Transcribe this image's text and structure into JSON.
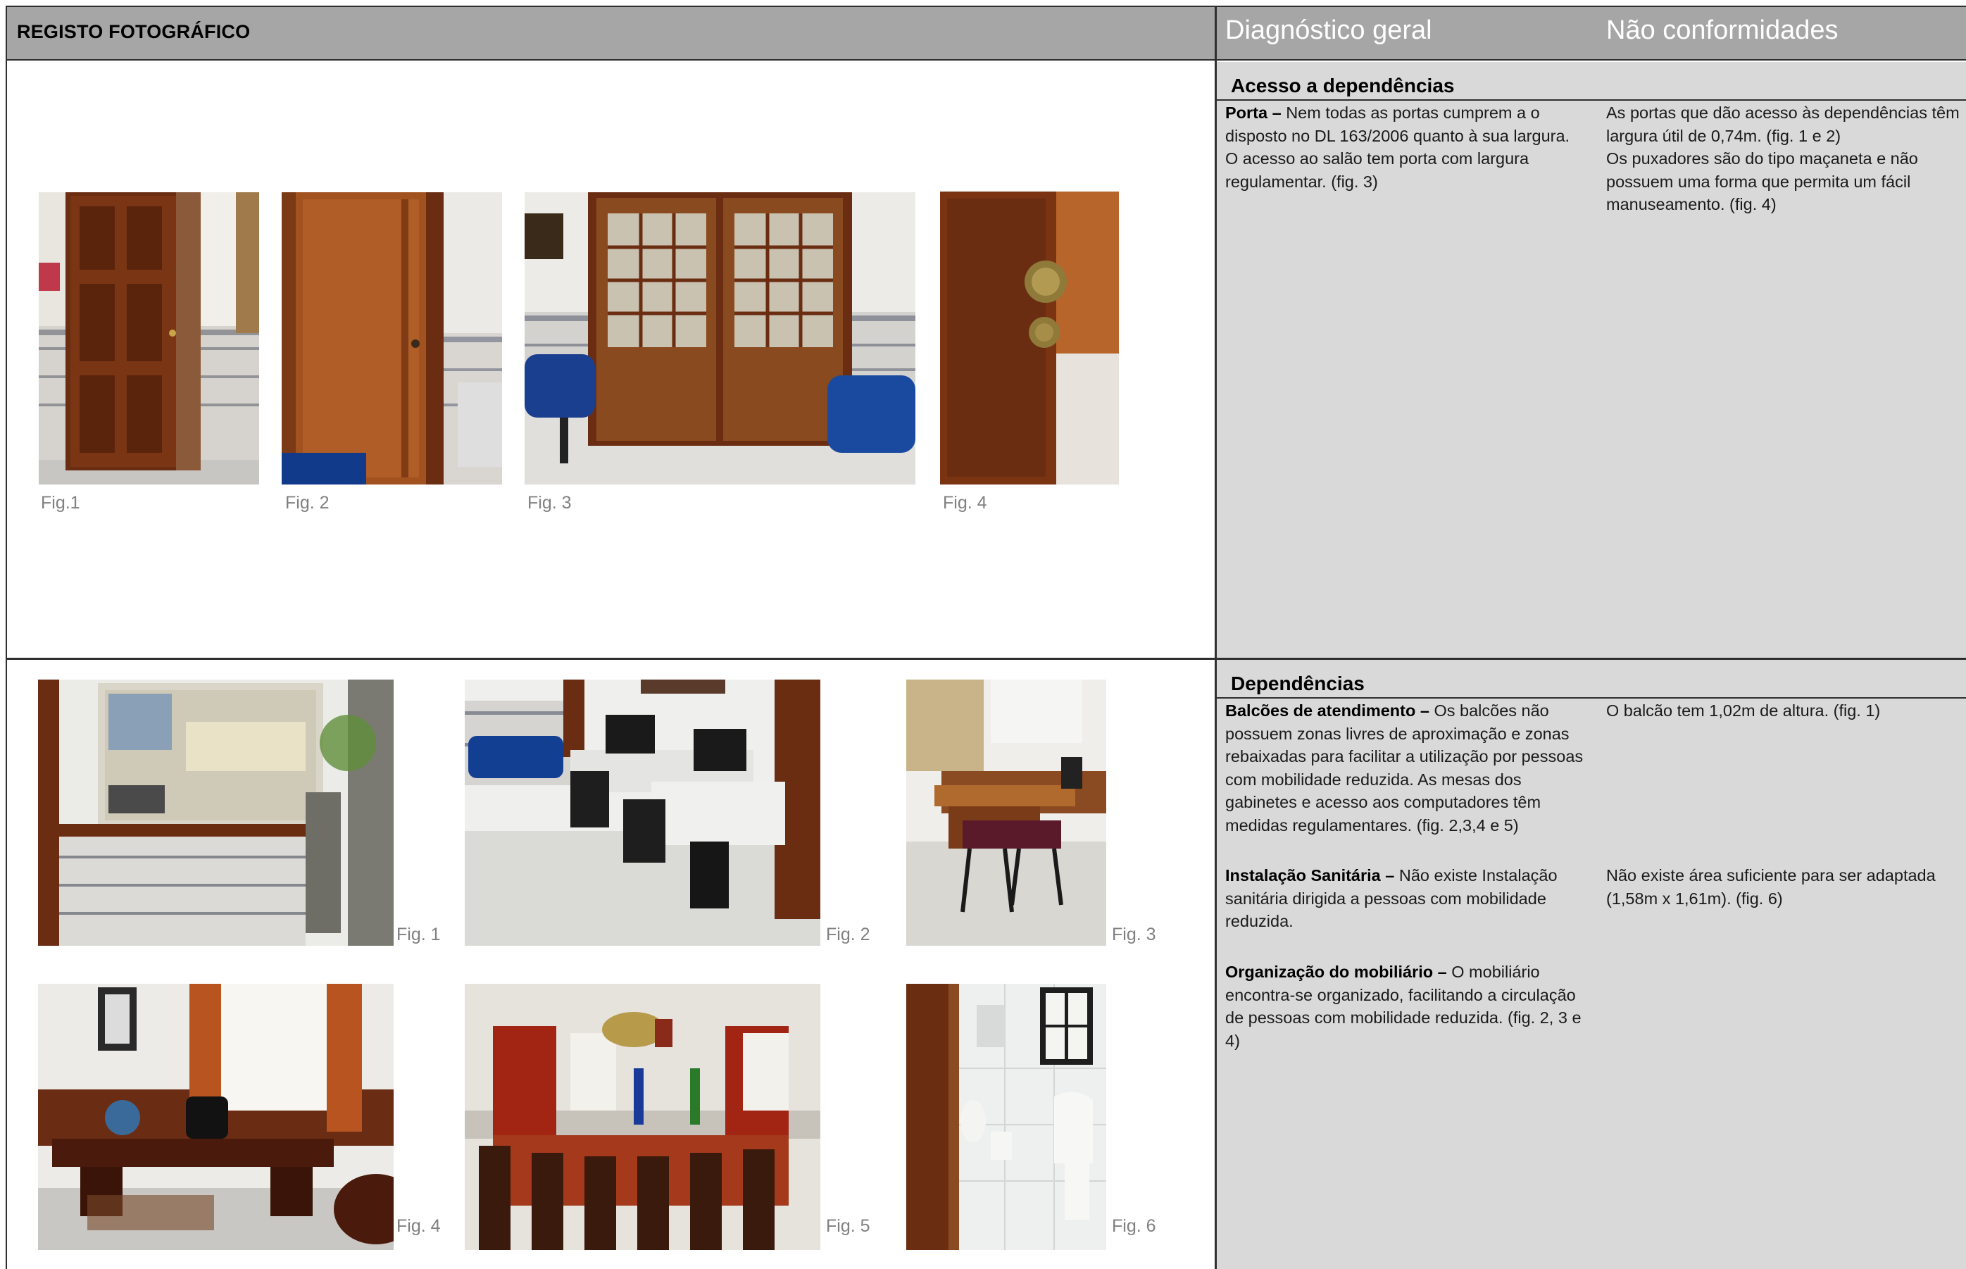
{
  "header": {
    "title": "REGISTO FOTOGRÁFICO",
    "col_diagnostico": "Diagnóstico geral",
    "col_nao_conformidades": "Não conformidades"
  },
  "section1": {
    "heading": "Acesso a dependências",
    "diagnostico": {
      "lead": "Porta – ",
      "text": "Nem todas as portas cumprem a o disposto no DL 163/2006 quanto à sua largura. O acesso ao salão tem porta com largura regulamentar. (fig. 3)"
    },
    "nao_conformidades": {
      "line1": "As portas que dão acesso às dependências têm largura útil de 0,74m. (fig. 1 e 2)",
      "line2": "Os puxadores são do tipo maçaneta e não possuem uma forma que permita um fácil manuseamento. (fig. 4)"
    },
    "captions": [
      "Fig.1",
      "Fig. 2",
      "Fig. 3",
      "Fig. 4"
    ]
  },
  "section2": {
    "heading": "Dependências",
    "diagnostico": [
      {
        "lead": "Balcões de atendimento – ",
        "text": "Os balcões não possuem zonas livres de aproximação e zonas rebaixadas para facilitar a utilização por pessoas com mobilidade reduzida. As mesas dos gabinetes e acesso aos computadores têm medidas regulamentares. (fig. 2,3,4 e 5)"
      },
      {
        "lead": "Instalação Sanitária – ",
        "text": "Não existe Instalação sanitária dirigida a pessoas com mobilidade reduzida."
      },
      {
        "lead": "Organização do mobiliário – ",
        "text": "O mobiliário encontra-se organizado, facilitando a circulação de pessoas com mobilidade reduzida. (fig. 2, 3 e 4)"
      }
    ],
    "nao_conformidades": [
      "O balcão tem 1,02m de altura. (fig. 1)",
      "Não existe área suficiente para ser adaptada (1,58m x 1,61m). (fig. 6)"
    ],
    "captions": [
      "Fig. 1",
      "Fig. 2",
      "Fig. 3",
      "Fig. 4",
      "Fig. 5",
      "Fig. 6"
    ]
  },
  "colors": {
    "header_bg": "#a6a6a6",
    "panel_bg": "#d9d9d9",
    "caption": "#808080",
    "wood": "#6b2d12"
  }
}
